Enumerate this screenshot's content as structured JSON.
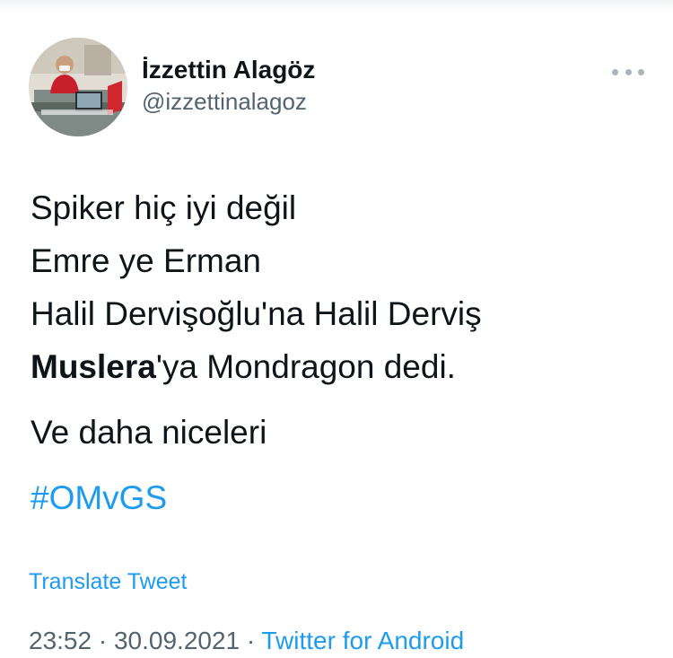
{
  "user": {
    "display_name": "İzzettin Alagöz",
    "handle": "@izzettinalagoz",
    "avatar_icon": "profile-photo"
  },
  "menu": {
    "more_icon": "more-horizontal-icon"
  },
  "tweet": {
    "lines": [
      {
        "text": "Spiker hiç iyi değil"
      },
      {
        "text": "Emre ye Erman"
      },
      {
        "text": "Halil Dervişoğlu'na Halil Derviş"
      },
      {
        "bold": "Muslera",
        "rest": "'ya Mondragon dedi."
      }
    ],
    "paragraph2": "Ve daha niceleri",
    "hashtag": "#OMvGS"
  },
  "actions": {
    "translate_label": "Translate Tweet"
  },
  "meta": {
    "time": "23:52",
    "separator": " · ",
    "date": "30.09.2021",
    "source": "Twitter for Android"
  },
  "colors": {
    "link": "#1d9bf0",
    "text": "#0f1419",
    "secondary": "#536471"
  }
}
